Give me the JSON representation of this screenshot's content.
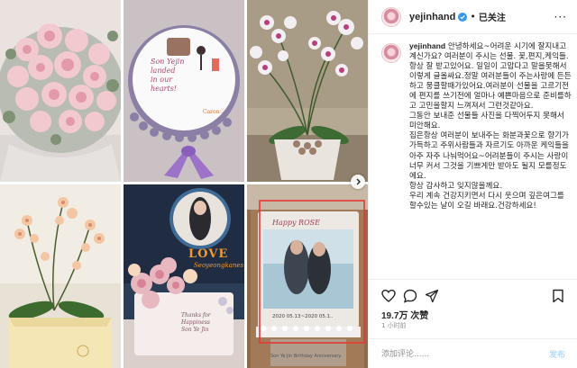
{
  "post": {
    "username": "yejinhand",
    "follow_status": "已关注",
    "separator": "•",
    "more": "···"
  },
  "caption": {
    "username": "yejinhand",
    "text": "안녕하세요~어려운 시기에 잘지내고계신가요? 여러분이 주시는 선물. 꽃,편지,케익들.항상 잘 받고있어요. 일일이 고맙다고 말을못해서 이렇게 글올싸요.정말 여러분들이 주는사랑에 든든하고 뭉클할때가있어요.여러분이 선물을 고르기전에 편지를 쓰기전에 얼마나 예쁜마음으로 준비를하고 고민을할지 느껴져서 그런것같아요.\n그동안 보내준 선물들 사진을 다찍어두지 못해서 미안해요.\n집은항상 여러분이 보내주는 화분과꽃으로 향기가 가득하고 주위사람들과 자르기도 아까운 케익들을 아주 자주 나눠먹어요~어려분들이 주시는 사랑이 너무 커서 그것을 기쁘게만 받아도 될지 모를정도에요.\n항상 감사하고 잊지않을께요.\n우리 계속 건강지키면서 다시 웃으며 깊은여그를 할수있는 날이 오길 바래요.건강하세요!"
  },
  "stats": {
    "likes": "19.7万 次赞",
    "time_ago": "1 小时前"
  },
  "comment": {
    "placeholder": "添加评论......",
    "post_label": "发布"
  },
  "photos": {
    "c2_cake_message": "Son Yejin\nlanded\nin our\nhearts!",
    "c2_tag": "Caron♡",
    "c5_love": "LOVE",
    "c5_name": "Seoyeongkanes",
    "c5_cake_text": "Thanks for\nHappiness\nSon Ye Jin",
    "c6_cake_text": "Happy ROSE",
    "c6_date": "2020 05.13~2020 05.1..",
    "c6_bottom": "Son Ye Jin Birthday Anniversary"
  },
  "colors": {
    "accent_blue": "#3897f0",
    "text": "#262626",
    "muted": "#8e8e8e",
    "border": "#efefef",
    "highlight_red": "#e53935"
  },
  "icons": [
    "heart-icon",
    "comment-icon",
    "share-icon",
    "bookmark-icon",
    "verified-icon",
    "chevron-right-icon",
    "more-icon"
  ]
}
